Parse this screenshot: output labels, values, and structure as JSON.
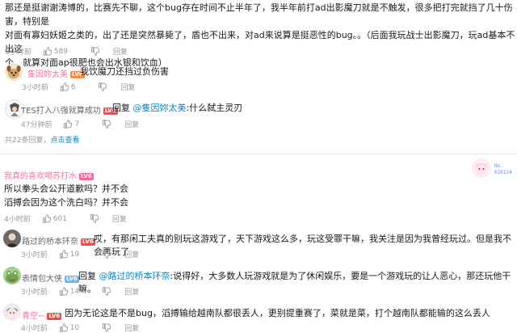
{
  "top_comment": {
    "lines": [
      "那还是挺谢谢涛博的，比赛先不聊，这个bug存在时间不止半年了，我半年前打ad出影魔刀就是不触发，很多把打完就挡了几十伤害，特别是",
      "对面有寡妇妖姬之类的，出了还是突然暴毙了，盾也不出来，对ad来说算是挺恶性的bug。。（后面我玩战士出影魔刀，玩ad基本不出这",
      "个，就算对面ap很肥也会出水银和饮血）"
    ],
    "time": "3小时前",
    "likes": "589",
    "reply": "回复"
  },
  "replies": [
    {
      "name": "隻因妳太美",
      "level": "LV6",
      "text": "我饮魔刀还挡过负伤害",
      "time": "3小时前",
      "likes": "6",
      "reply": "回复"
    },
    {
      "name": "TES打入八强就算成功",
      "level": "LV6",
      "prefix": "回复",
      "mention": "@隻因妳太美",
      "text": ":什么弑主灵刃",
      "time": "47分钟前",
      "likes": "7",
      "reply": "回复"
    }
  ],
  "reply_count": "共22条回复，",
  "view_more": "点击查看",
  "second_comment": {
    "name": "我真的喜欢喝苏打水",
    "level": "LV6",
    "lines": [
      "所以拳头会公开道歉吗？并不会",
      "滔搏会因为这个洗白吗？并不会"
    ],
    "time": "4小时前",
    "likes": "601",
    "reply": "回复",
    "badge_label": "No.",
    "badge_number": "026124"
  },
  "replies2": [
    {
      "name": "路过的桥本环奈",
      "level": "LV6",
      "text": "哎，有那闲工夫真的别玩这游戏了，天下游戏这么多，玩这受罪干嘛，我关注是因为我曾经玩过。但是我不会再玩了",
      "time": "3小时前",
      "likes": "19",
      "reply": "回复"
    },
    {
      "name": "表情包大侠",
      "level": "LV6",
      "prefix": "回复",
      "mention": "@路过的桥本环奈",
      "text": ":说得好，大多数人玩游戏就是为了休闲娱乐，要是一个游戏玩的让人恶心，那还玩他干嘛。",
      "time": "3小时前",
      "likes": "14",
      "reply": "回复"
    },
    {
      "name": "青空~",
      "level": "LV6",
      "text": "因为无论这是不是bug，滔搏输给越南队都很丢人，更别提重赛了，菜就是菜，打个越南队都能输的这么丢人",
      "time": "4小时前",
      "likes": "10",
      "reply": "回复"
    }
  ],
  "colors": {
    "pink": "#fb7299",
    "link": "#008ac5",
    "meta": "#9499a0"
  }
}
